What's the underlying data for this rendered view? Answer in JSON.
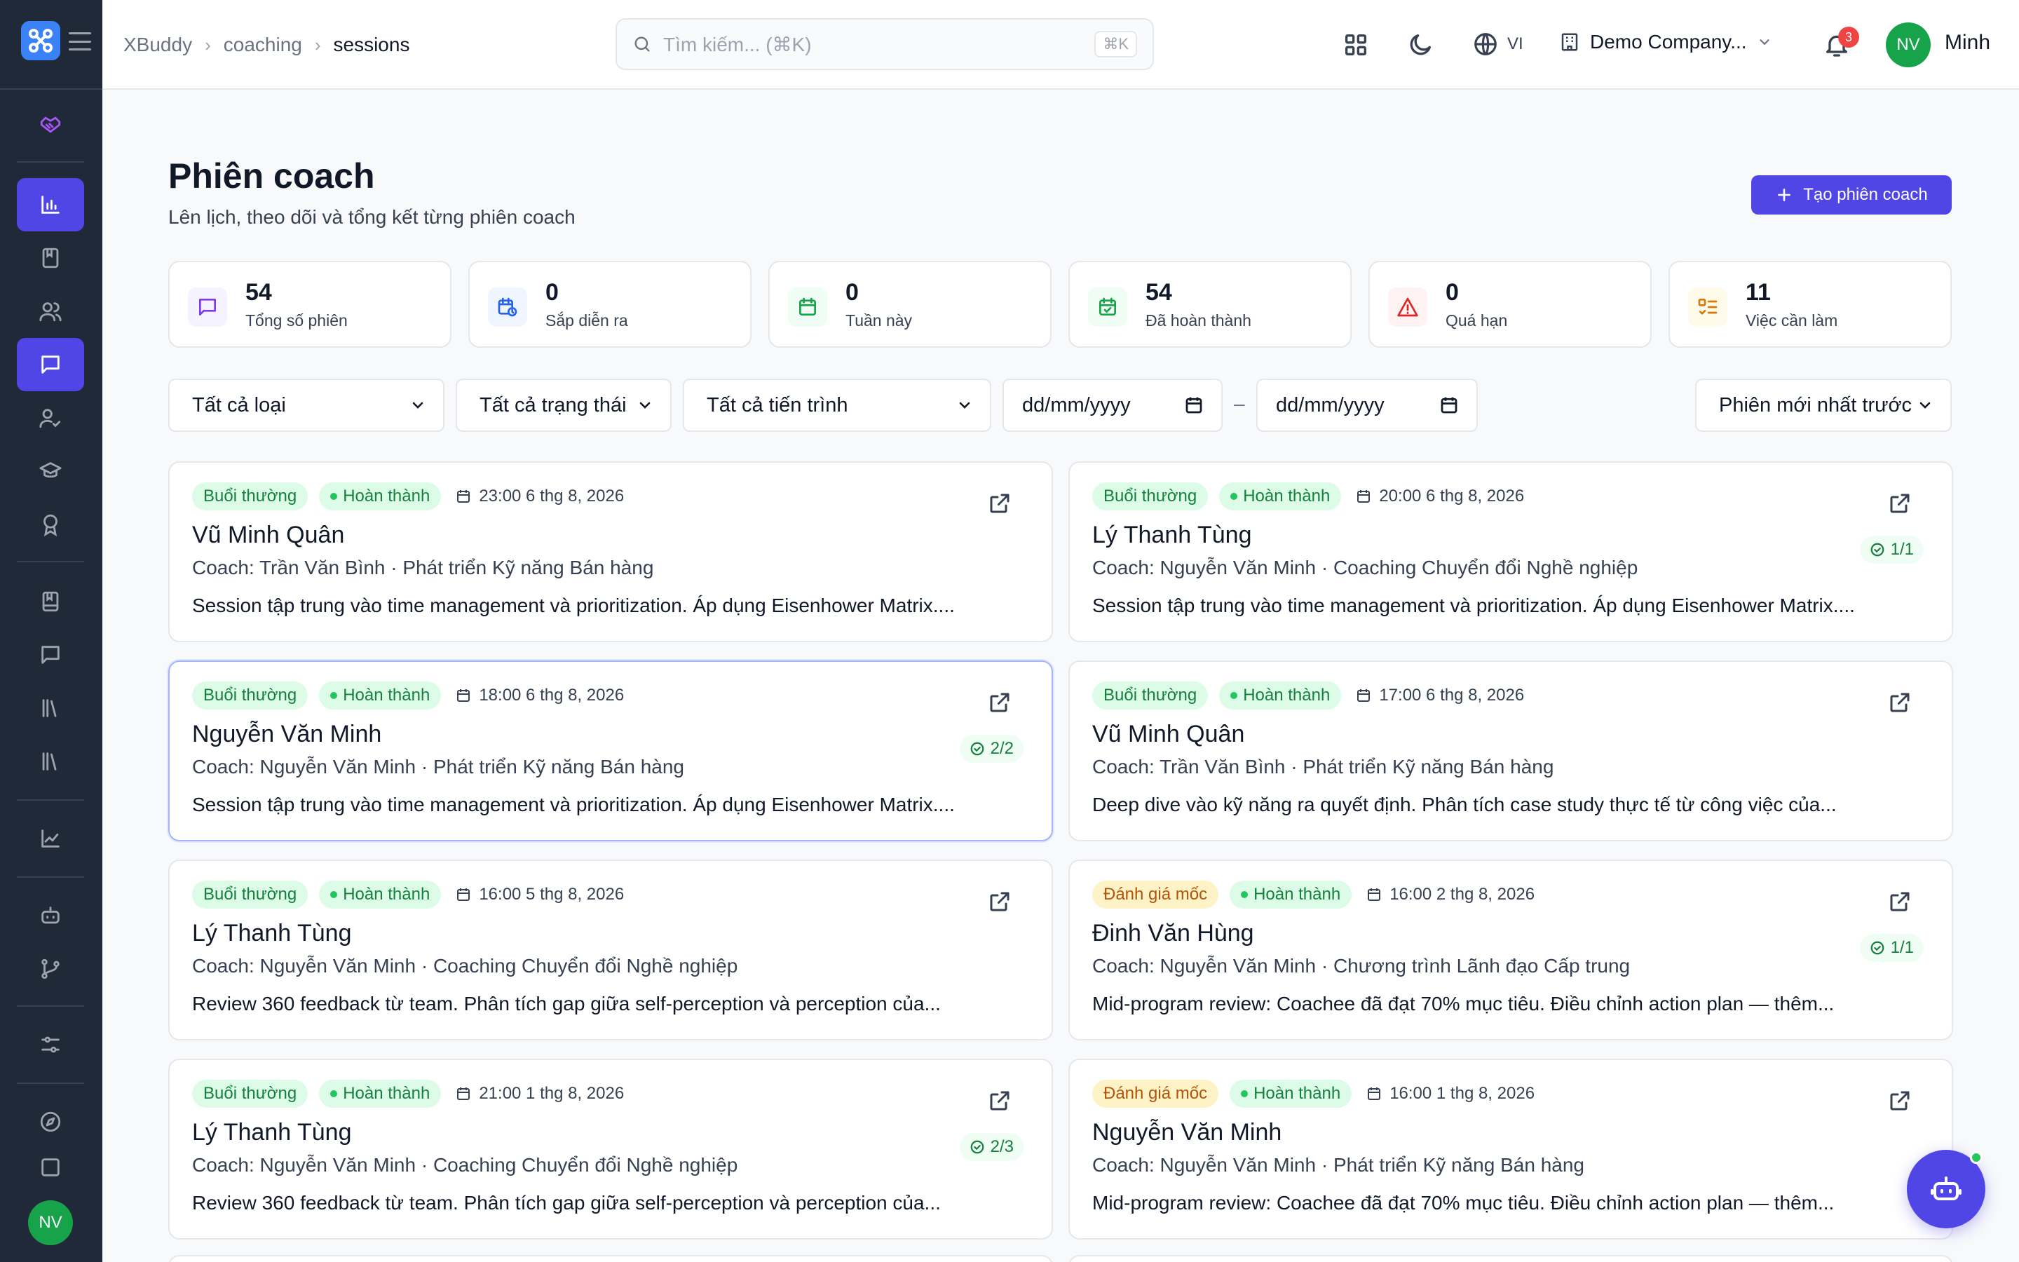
{
  "sidebar": {
    "avatar": "NV"
  },
  "header": {
    "breadcrumbs": [
      "XBuddy",
      "coaching",
      "sessions"
    ],
    "search_placeholder": "Tìm kiếm... (⌘K)",
    "search_shortcut": "⌘K",
    "language": "VI",
    "company": "Demo Company...",
    "notifications": "3",
    "user_initials": "NV",
    "user_name": "Minh"
  },
  "page": {
    "title": "Phiên coach",
    "subtitle": "Lên lịch, theo dõi và tổng kết từng phiên coach",
    "create_button": "Tạo phiên coach"
  },
  "stats": [
    {
      "value": "54",
      "label": "Tổng số phiên",
      "icon": "message-square-icon",
      "color": "#7c3aed"
    },
    {
      "value": "0",
      "label": "Sắp diễn ra",
      "icon": "calendar-clock-icon",
      "color": "#2563eb"
    },
    {
      "value": "0",
      "label": "Tuần này",
      "icon": "calendar-icon",
      "color": "#16a34a"
    },
    {
      "value": "54",
      "label": "Đã hoàn thành",
      "icon": "calendar-check-icon",
      "color": "#16a34a"
    },
    {
      "value": "0",
      "label": "Quá hạn",
      "icon": "alert-triangle-icon",
      "color": "#dc2626"
    },
    {
      "value": "11",
      "label": "Việc cần làm",
      "icon": "list-todo-icon",
      "color": "#d97706"
    }
  ],
  "filters": {
    "type": "Tất cả loại",
    "status": "Tất cả trạng thái",
    "progress": "Tất cả tiến trình",
    "date_from": "dd/mm/yyyy",
    "date_to": "dd/mm/yyyy",
    "date_sep": "–",
    "sort": "Phiên mới nhất trước"
  },
  "sessions": [
    {
      "type": "Buổi thường",
      "type_color": "green",
      "status": "Hoàn thành",
      "date": "23:00 6 thg 8, 2026",
      "name": "Vũ Minh Quân",
      "coach": "Coach: Trần Văn Bình · Phát triển Kỹ năng Bán hàng",
      "desc": "Session tập trung vào time management và prioritization. Áp dụng Eisenhower Matrix....",
      "progress": ""
    },
    {
      "type": "Buổi thường",
      "type_color": "green",
      "status": "Hoàn thành",
      "date": "20:00 6 thg 8, 2026",
      "name": "Lý Thanh Tùng",
      "coach": "Coach: Nguyễn Văn Minh · Coaching Chuyển đổi Nghề nghiệp",
      "desc": "Session tập trung vào time management và prioritization. Áp dụng Eisenhower Matrix....",
      "progress": "1/1"
    },
    {
      "type": "Buổi thường",
      "type_color": "green",
      "status": "Hoàn thành",
      "date": "18:00 6 thg 8, 2026",
      "name": "Nguyễn Văn Minh",
      "coach": "Coach: Nguyễn Văn Minh · Phát triển Kỹ năng Bán hàng",
      "desc": "Session tập trung vào time management và prioritization. Áp dụng Eisenhower Matrix....",
      "progress": "2/2"
    },
    {
      "type": "Buổi thường",
      "type_color": "green",
      "status": "Hoàn thành",
      "date": "17:00 6 thg 8, 2026",
      "name": "Vũ Minh Quân",
      "coach": "Coach: Trần Văn Bình · Phát triển Kỹ năng Bán hàng",
      "desc": "Deep dive vào kỹ năng ra quyết định. Phân tích case study thực tế từ công việc của...",
      "progress": ""
    },
    {
      "type": "Buổi thường",
      "type_color": "green",
      "status": "Hoàn thành",
      "date": "16:00 5 thg 8, 2026",
      "name": "Lý Thanh Tùng",
      "coach": "Coach: Nguyễn Văn Minh · Coaching Chuyển đổi Nghề nghiệp",
      "desc": "Review 360 feedback từ team. Phân tích gap giữa self-perception và perception của...",
      "progress": ""
    },
    {
      "type": "Đánh giá mốc",
      "type_color": "yellow",
      "status": "Hoàn thành",
      "date": "16:00 2 thg 8, 2026",
      "name": "Đinh Văn Hùng",
      "coach": "Coach: Nguyễn Văn Minh · Chương trình Lãnh đạo Cấp trung",
      "desc": "Mid-program review: Coachee đã đạt 70% mục tiêu. Điều chỉnh action plan — thêm...",
      "progress": "1/1"
    },
    {
      "type": "Buổi thường",
      "type_color": "green",
      "status": "Hoàn thành",
      "date": "21:00 1 thg 8, 2026",
      "name": "Lý Thanh Tùng",
      "coach": "Coach: Nguyễn Văn Minh · Coaching Chuyển đổi Nghề nghiệp",
      "desc": "Review 360 feedback từ team. Phân tích gap giữa self-perception và perception của...",
      "progress": "2/3"
    },
    {
      "type": "Đánh giá mốc",
      "type_color": "yellow",
      "status": "Hoàn thành",
      "date": "16:00 1 thg 8, 2026",
      "name": "Nguyễn Văn Minh",
      "coach": "Coach: Nguyễn Văn Minh · Phát triển Kỹ năng Bán hàng",
      "desc": "Mid-program review: Coachee đã đạt 70% mục tiêu. Điều chỉnh action plan — thêm...",
      "progress": ""
    }
  ]
}
